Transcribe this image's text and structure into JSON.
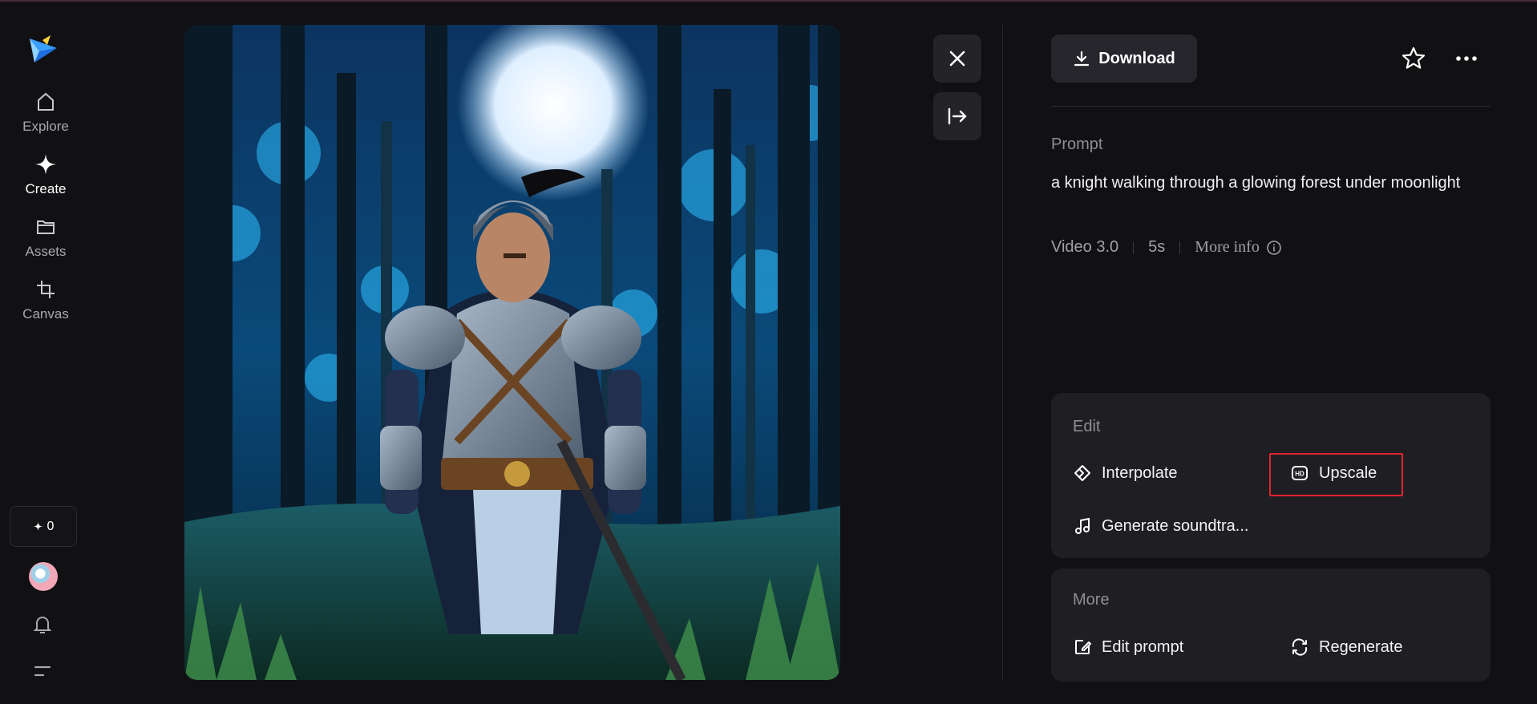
{
  "nav": {
    "items": [
      {
        "label": "Explore",
        "icon": "home-icon"
      },
      {
        "label": "Create",
        "icon": "sparkle-icon",
        "active": true
      },
      {
        "label": "Assets",
        "icon": "folder-icon"
      },
      {
        "label": "Canvas",
        "icon": "crop-icon"
      }
    ],
    "credits": "0"
  },
  "panel": {
    "download_label": "Download",
    "prompt_label": "Prompt",
    "prompt_text": "a knight walking through a glowing forest under moonlight",
    "meta": {
      "model": "Video 3.0",
      "duration": "5s",
      "more_info": "More info"
    },
    "edit": {
      "title": "Edit",
      "interpolate": "Interpolate",
      "upscale": "Upscale",
      "soundtrack": "Generate soundtra..."
    },
    "more": {
      "title": "More",
      "edit_prompt": "Edit prompt",
      "regenerate": "Regenerate"
    }
  },
  "colors": {
    "background": "#111114",
    "card": "#1e1e23",
    "highlight": "#e0242f",
    "logo_accent": "#3aa0ff"
  }
}
